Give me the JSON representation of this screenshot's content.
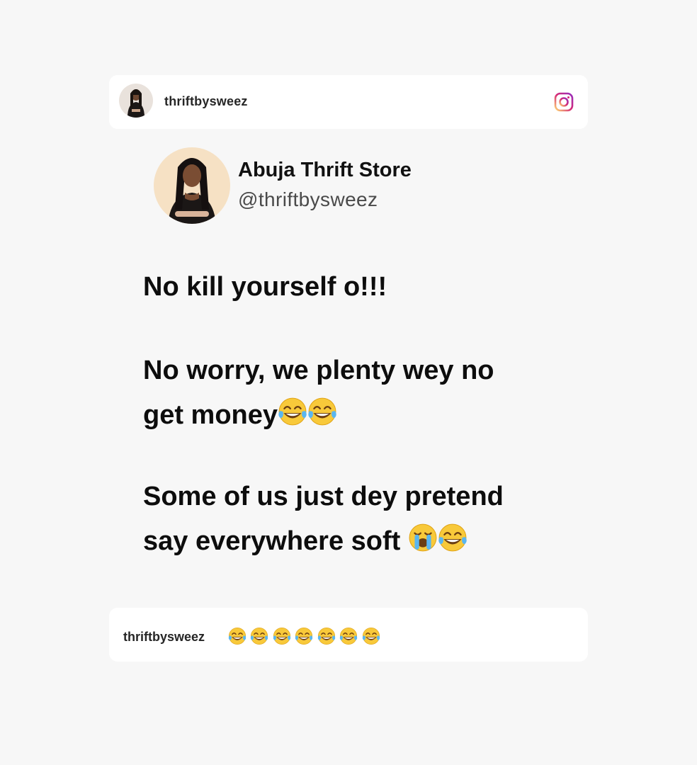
{
  "post_header": {
    "username": "thriftbysweez",
    "instagram_icon": "instagram-icon"
  },
  "tweet": {
    "display_name": "Abuja Thrift Store",
    "handle": "@thriftbysweez",
    "lines": [
      "No kill yourself o!!!",
      "No worry, we plenty wey no",
      "get money",
      "Some of us just dey pretend",
      "say everywhere soft "
    ],
    "emojis": {
      "line3": [
        "face-with-tears-of-joy",
        "face-with-tears-of-joy"
      ],
      "line5": [
        "loudly-crying-face",
        "face-with-tears-of-joy"
      ]
    }
  },
  "caption": {
    "username": "thriftbysweez",
    "emojis": [
      "face-with-tears-of-joy",
      "face-with-tears-of-joy",
      "face-with-tears-of-joy",
      "face-with-tears-of-joy",
      "face-with-tears-of-joy",
      "face-with-tears-of-joy",
      "face-with-tears-of-joy"
    ]
  },
  "colors": {
    "background": "#f7f7f7",
    "card": "#ffffff",
    "text": "#0d0d0d",
    "handle": "#4a4a4a",
    "instagram_gradient": [
      "#feda75",
      "#d62976",
      "#962fbf"
    ]
  }
}
